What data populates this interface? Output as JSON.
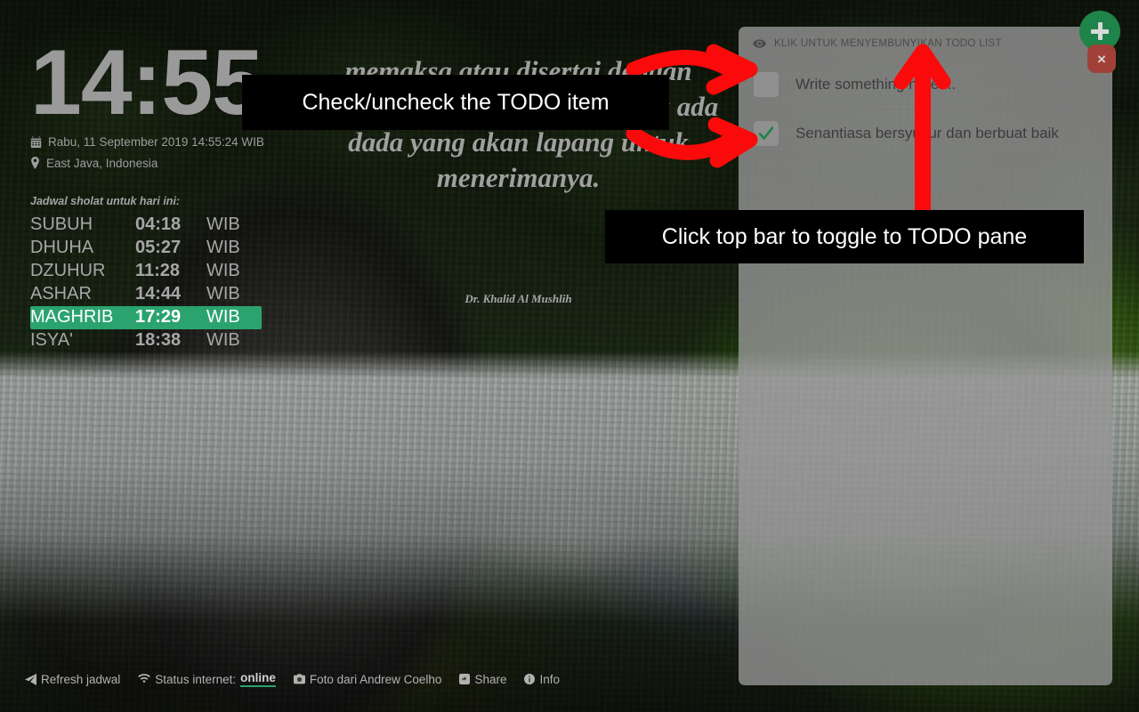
{
  "clock": {
    "time": "14:55"
  },
  "meta": {
    "date_icon": "calendar-icon",
    "date": "Rabu, 11 September 2019 14:55:24 WIB",
    "location_icon": "map-pin-icon",
    "location": "East Java, Indonesia"
  },
  "schedule": {
    "caption": "Jadwal sholat untuk hari ini:",
    "active_name": "MAGHRIB",
    "highlight_color": "#2ba36f",
    "rows": [
      {
        "name": "SUBUH",
        "time": "04:18",
        "zone": "WIB"
      },
      {
        "name": "DHUHA",
        "time": "05:27",
        "zone": "WIB"
      },
      {
        "name": "DZUHUR",
        "time": "11:28",
        "zone": "WIB"
      },
      {
        "name": "ASHAR",
        "time": "14:44",
        "zone": "WIB"
      },
      {
        "name": "MAGHRIB",
        "time": "17:29",
        "zone": "WIB"
      },
      {
        "name": "ISYA'",
        "time": "18:38",
        "zone": "WIB"
      }
    ]
  },
  "quote": {
    "text": "memaksa atau disertai dengan umpatan dan celaan, maka tak ada dada yang akan lapang untuk menerimanya.",
    "author": "Dr. Khalid Al Mushlih"
  },
  "bottom_bar": {
    "refresh_icon": "paper-plane-icon",
    "refresh_label": "Refresh jadwal",
    "wifi_icon": "wifi-icon",
    "internet_label": "Status internet:",
    "internet_status": "online",
    "photo_icon": "camera-icon",
    "photo_label": "Foto dari Andrew Coelho",
    "share_icon": "share-icon",
    "share_label": "Share",
    "info_icon": "info-icon",
    "info_label": "Info"
  },
  "todo": {
    "header_icon": "eye-icon",
    "header_label": "KLIK UNTUK MENYEMBUNYIKAN TODO LIST",
    "add_button": "add-icon",
    "delete_button": "×",
    "add_color": "#1e8449",
    "delete_color": "#a14038",
    "items": [
      {
        "text": "Write something here ...",
        "checked": false
      },
      {
        "text": "Senantiasa bersyukur dan berbuat baik",
        "checked": true
      }
    ]
  },
  "annotations": {
    "arrow_color": "#fa0a0a",
    "callout_1": "Check/uncheck the TODO item",
    "callout_2": "Click top bar to toggle to TODO pane"
  }
}
